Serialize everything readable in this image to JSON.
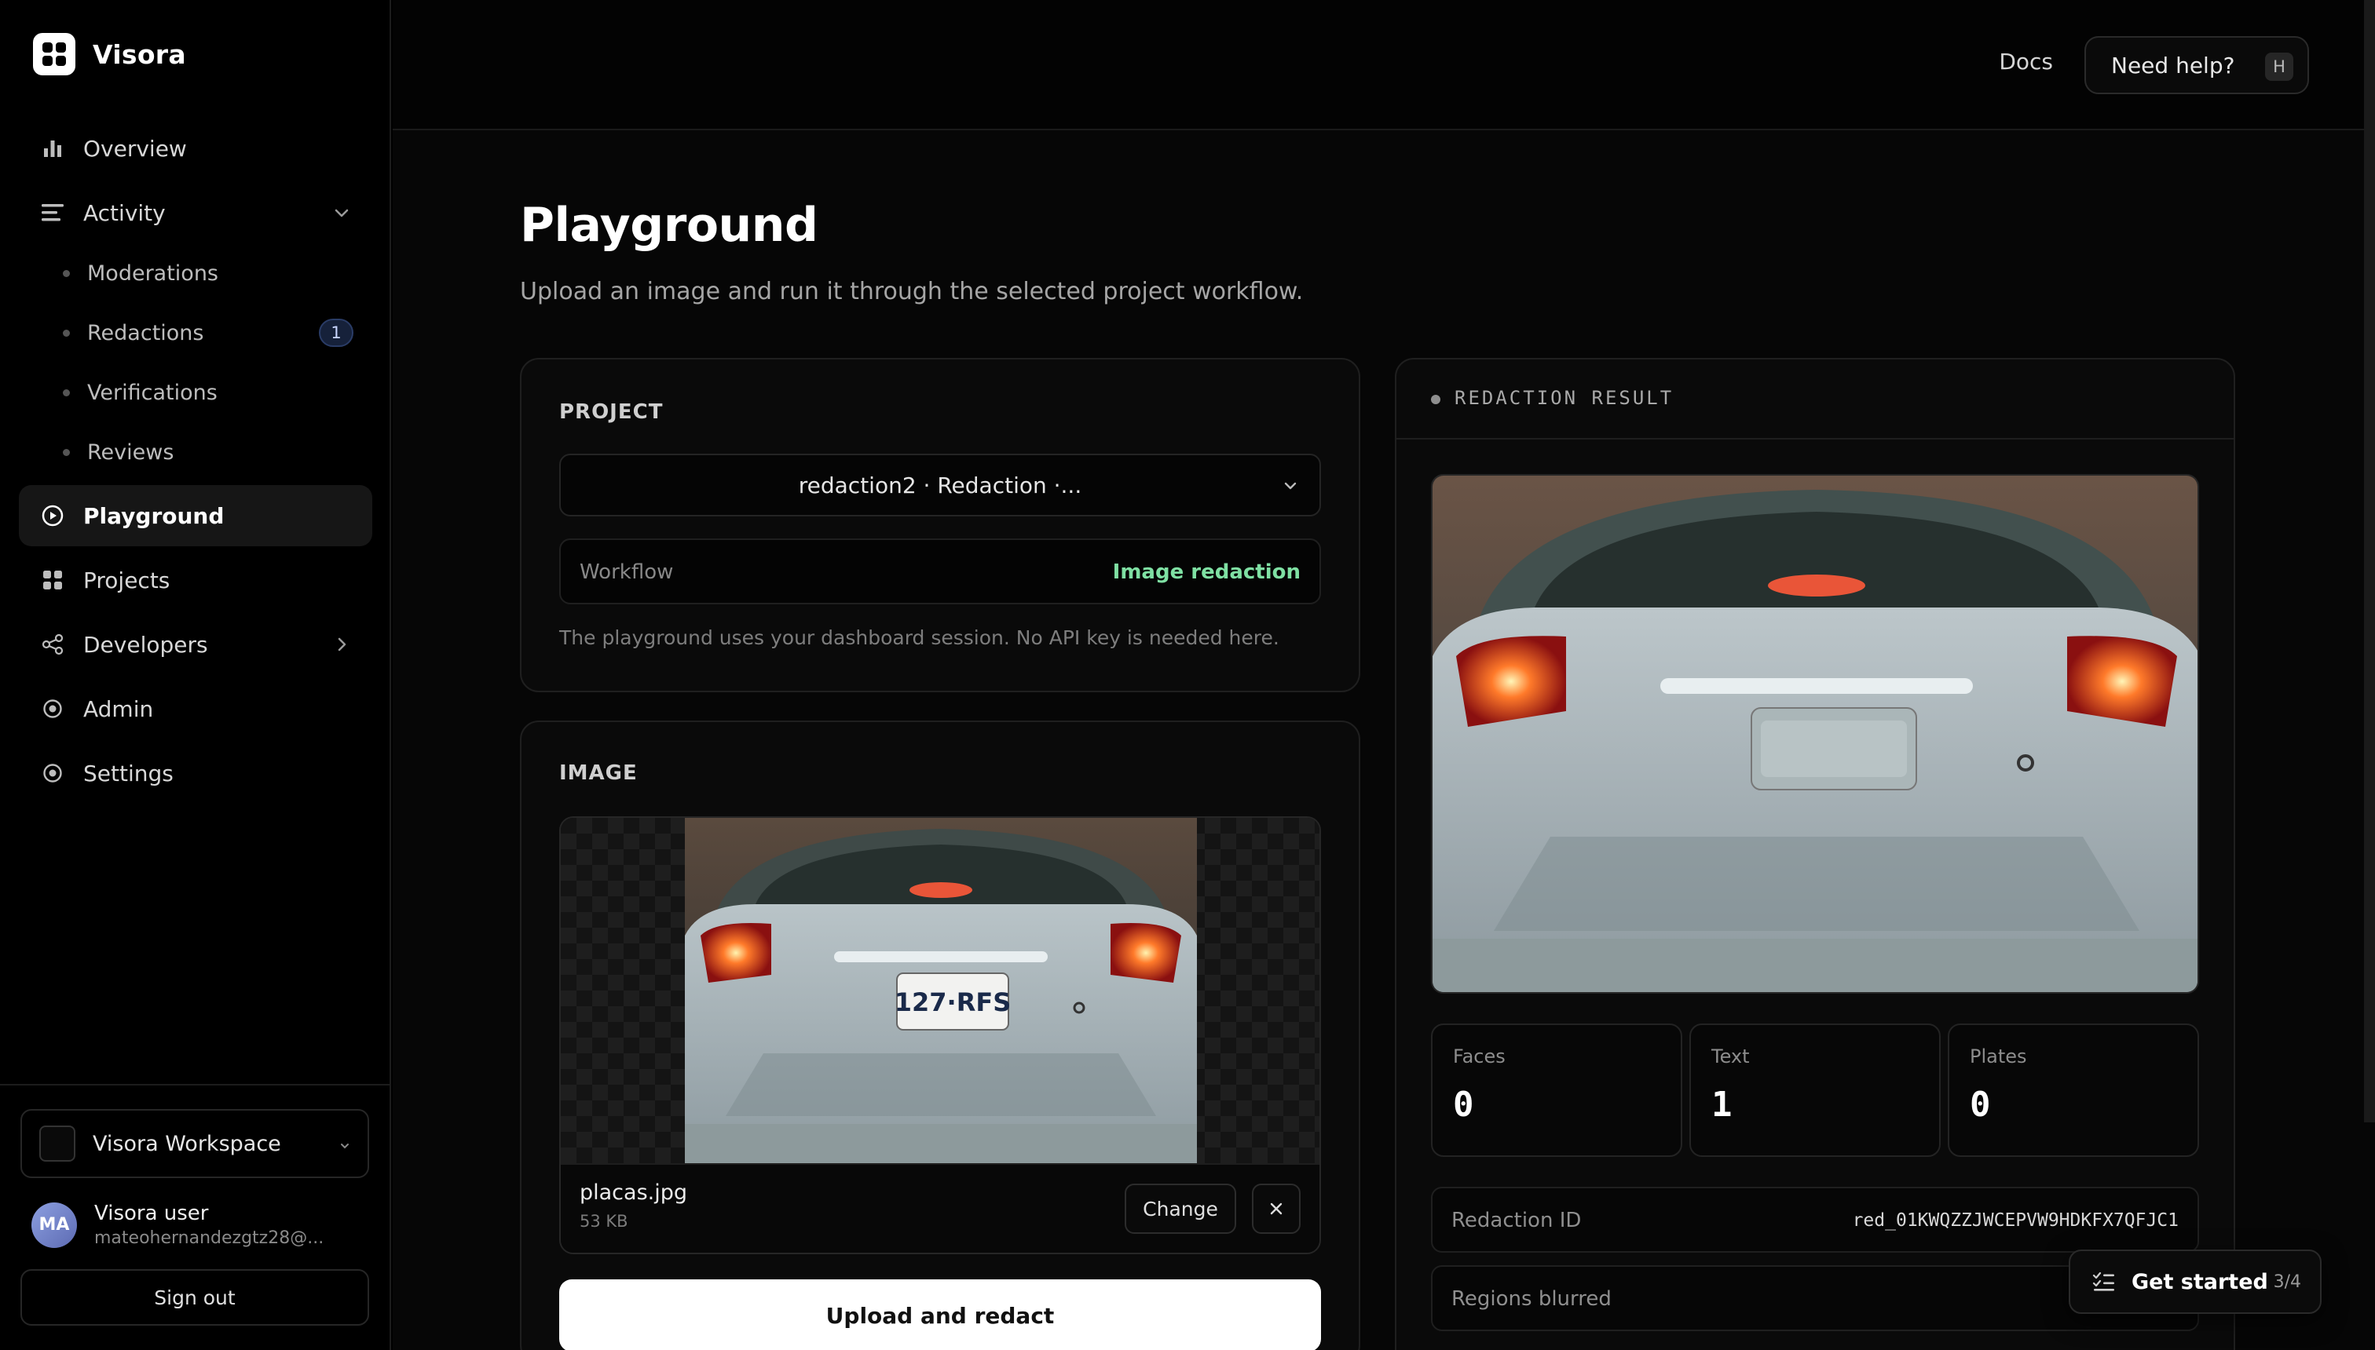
{
  "app": {
    "name": "Visora"
  },
  "sidebar": {
    "nav": {
      "overview": "Overview",
      "activity": "Activity",
      "playground": "Playground",
      "projects": "Projects",
      "developers": "Developers",
      "admin": "Admin",
      "settings": "Settings"
    },
    "activity_items": [
      {
        "label": "Moderations"
      },
      {
        "label": "Redactions",
        "badge": "1"
      },
      {
        "label": "Verifications"
      },
      {
        "label": "Reviews"
      }
    ],
    "workspace": "Visora Workspace",
    "user": {
      "initials": "MA",
      "name": "Visora user",
      "email": "mateohernandezgtz28@..."
    },
    "sign_out": "Sign out"
  },
  "header": {
    "docs": "Docs",
    "help": "Need help?",
    "help_key": "H"
  },
  "page": {
    "title": "Playground",
    "subtitle": "Upload an image and run it through the selected project workflow."
  },
  "project_card": {
    "title": "PROJECT",
    "selected_project": "redaction2 · Redaction ·...",
    "workflow_label": "Workflow",
    "workflow_value": "Image redaction",
    "note": "The playground uses your dashboard session. No API key is needed here."
  },
  "image_card": {
    "title": "IMAGE",
    "file_name": "placas.jpg",
    "file_size": "53 KB",
    "change": "Change",
    "upload": "Upload and redact",
    "plate_text": "127·RFS"
  },
  "result_card": {
    "title": "REDACTION RESULT",
    "stats": [
      {
        "label": "Faces",
        "value": "0"
      },
      {
        "label": "Text",
        "value": "1"
      },
      {
        "label": "Plates",
        "value": "0"
      }
    ],
    "redaction_id_label": "Redaction ID",
    "redaction_id": "red_01KWQZZJWCEPVW9HDKFX7QFJC1",
    "regions_label": "Regions blurred"
  },
  "get_started": {
    "label": "Get started",
    "progress": "3/4"
  },
  "colors": {
    "accent_green": "#7fe0a3",
    "badge_blue": "#16213a",
    "background": "#000000"
  }
}
